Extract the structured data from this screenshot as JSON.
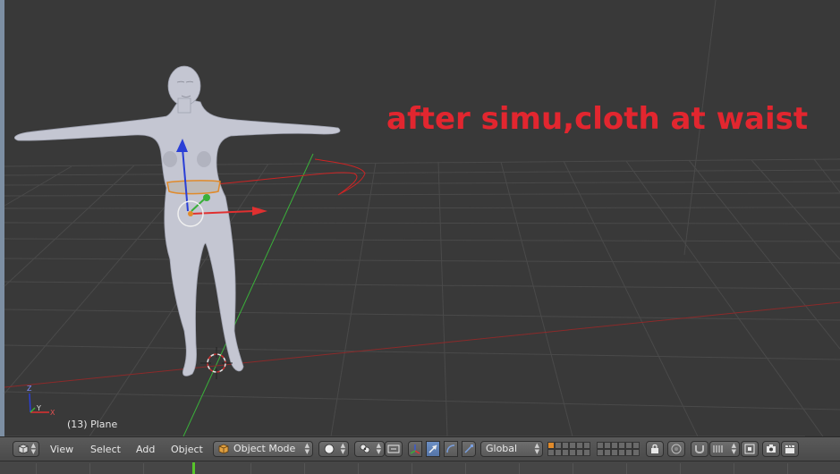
{
  "viewport": {
    "annotation": "after simu,cloth at waist",
    "object_label": "(13) Plane"
  },
  "header": {
    "menus": [
      "View",
      "Select",
      "Add",
      "Object"
    ],
    "mode": "Object Mode",
    "orientation": "Global"
  },
  "colors": {
    "annotation": "#e2262f",
    "viewport_bg": "#393939",
    "selection_orange": "#e08a2a",
    "x_axis": "#e03030",
    "y_axis": "#3ab03a",
    "z_axis": "#2a3fd6",
    "active_button": "#5a7fb8",
    "current_frame": "#57c52a"
  },
  "icons": {
    "editor_type": "3d-view-cube-icon",
    "mode": "object-mode-cube-icon",
    "shading": "solid-sphere-icon",
    "pivot": "pivot-point-icon",
    "manipulator": "manipulator-icon",
    "snap": "magnet-icon",
    "render": "camera-render-icon"
  }
}
